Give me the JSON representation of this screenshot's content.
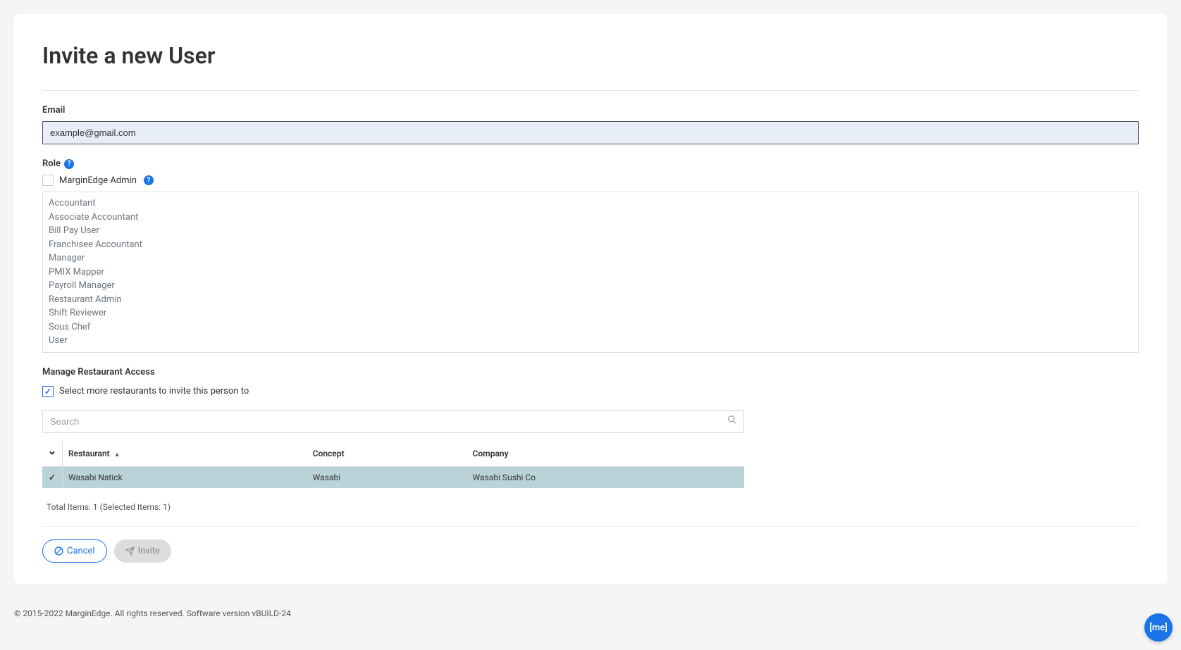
{
  "page": {
    "title": "Invite a new User"
  },
  "form": {
    "email_label": "Email",
    "email_value": "example@gmail.com",
    "role_label": "Role",
    "admin_checkbox_label": "MarginEdge Admin",
    "admin_checked": false,
    "roles": [
      "Accountant",
      "Associate Accountant",
      "Bill Pay User",
      "Franchisee Accountant",
      "Manager",
      "PMIX Mapper",
      "Payroll Manager",
      "Restaurant Admin",
      "Shift Reviewer",
      "Sous Chef",
      "User"
    ],
    "manage_access_label": "Manage Restaurant Access",
    "select_more_label": "Select more restaurants to invite this person to",
    "select_more_checked": true,
    "search_placeholder": "Search"
  },
  "table": {
    "columns": {
      "restaurant": "Restaurant",
      "concept": "Concept",
      "company": "Company"
    },
    "rows": [
      {
        "selected": true,
        "restaurant": "Wasabi Natick",
        "concept": "Wasabi",
        "company": "Wasabi Sushi Co"
      }
    ],
    "summary": "Total Items: 1 (Selected Items: 1)"
  },
  "buttons": {
    "cancel": "Cancel",
    "invite": "Invite"
  },
  "footer": {
    "copyright": "© 2015-2022 MarginEdge. All rights reserved. Software version vBUILD-24"
  },
  "fab": {
    "label": "[me]"
  }
}
